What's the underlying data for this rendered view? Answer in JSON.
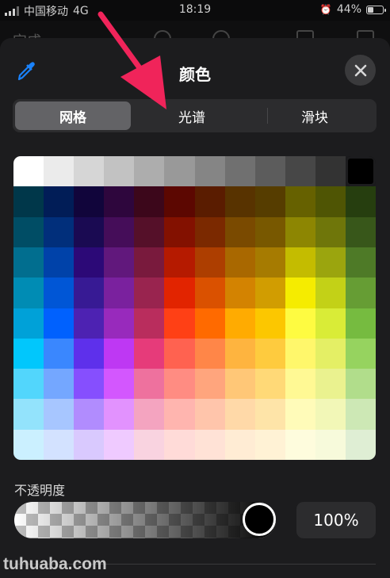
{
  "status_bar": {
    "carrier": "中国移动",
    "network": "4G",
    "time": "18:19",
    "battery_text": "44%",
    "battery_level": 0.44
  },
  "background_toolbar": {
    "done_label": "完成"
  },
  "color_picker": {
    "title": "颜色",
    "tabs": [
      {
        "label": "网格",
        "active": true
      },
      {
        "label": "光谱",
        "active": false
      },
      {
        "label": "滑块",
        "active": false
      }
    ],
    "grid_colors": [
      [
        "#ffffff",
        "#ebebeb",
        "#d6d6d6",
        "#c2c2c2",
        "#adadad",
        "#999999",
        "#858585",
        "#707070",
        "#5c5c5c",
        "#474747",
        "#333333",
        "#000000"
      ],
      [
        "#00374a",
        "#011d57",
        "#11053b",
        "#2e063d",
        "#3c071b",
        "#5c0701",
        "#5a1c00",
        "#583300",
        "#563d00",
        "#666100",
        "#4f5504",
        "#263e0f"
      ],
      [
        "#004d65",
        "#012f7b",
        "#1a0a52",
        "#450d59",
        "#551029",
        "#831100",
        "#7b2900",
        "#7a4a00",
        "#785800",
        "#8d8602",
        "#6f760a",
        "#38571a"
      ],
      [
        "#016e8f",
        "#0042a9",
        "#2c0977",
        "#61187c",
        "#791a3d",
        "#b51a00",
        "#ad3e00",
        "#a96800",
        "#a67b01",
        "#c4bc00",
        "#9ba50e",
        "#4e7a27"
      ],
      [
        "#008cb4",
        "#0056d6",
        "#371a94",
        "#7a219e",
        "#99244f",
        "#e22400",
        "#da5100",
        "#d38301",
        "#d19d01",
        "#f5ec00",
        "#c3d117",
        "#669d34"
      ],
      [
        "#00a1d8",
        "#0061fe",
        "#4d22b2",
        "#982abc",
        "#b92d5d",
        "#ff4015",
        "#ff6a00",
        "#ffab01",
        "#fcc700",
        "#fefb41",
        "#d9ec37",
        "#76bb40"
      ],
      [
        "#01c7fc",
        "#3a87fe",
        "#5e30eb",
        "#be38f3",
        "#e63b7a",
        "#ff6250",
        "#ff8648",
        "#feb43f",
        "#fecb3e",
        "#fff76b",
        "#e4ef65",
        "#96d35f"
      ],
      [
        "#52d6fc",
        "#74a7ff",
        "#864ffe",
        "#d357fe",
        "#ee719e",
        "#ff8c82",
        "#ffa57d",
        "#ffc777",
        "#ffd977",
        "#fff994",
        "#eaf28f",
        "#b1dd8b"
      ],
      [
        "#93e3fc",
        "#a7c6ff",
        "#b18cfe",
        "#e292fe",
        "#f4a4c0",
        "#ffb5af",
        "#ffc5ab",
        "#ffd9a8",
        "#fee4a8",
        "#fffbb9",
        "#f2f7b7",
        "#cde8b5"
      ],
      [
        "#cbf0ff",
        "#d3e2ff",
        "#d9c9fe",
        "#efcaff",
        "#f9d3e0",
        "#ffdbd8",
        "#ffe2d6",
        "#ffecd4",
        "#fff2d5",
        "#fefcdd",
        "#f7fadb",
        "#dfeed4"
      ]
    ],
    "opacity_label": "不透明度",
    "opacity_value_text": "100%",
    "opacity_level": 1.0
  },
  "watermark": "tuhuaba.com",
  "colors": {
    "sheet_bg": "#1c1c1e",
    "control_bg": "#2c2c2e",
    "active_tab": "#636366",
    "annotation_arrow": "#f0245a",
    "eyedropper_blue": "#1a82fb"
  }
}
